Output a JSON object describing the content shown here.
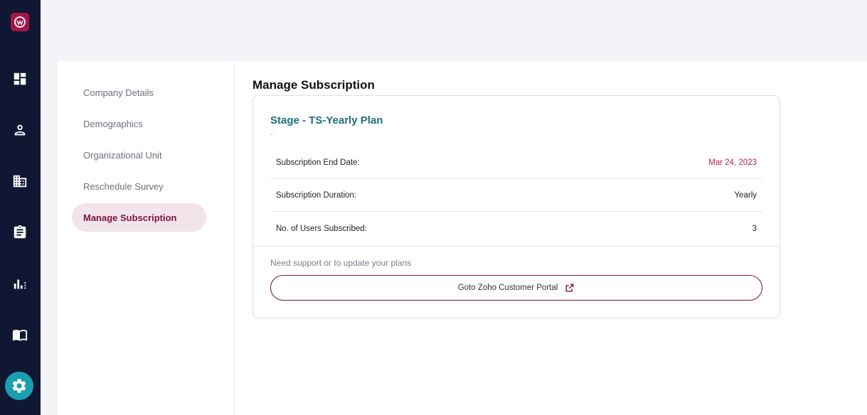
{
  "nav": {
    "items": [
      {
        "name": "dashboard",
        "icon": "dashboard-icon"
      },
      {
        "name": "people",
        "icon": "person-icon"
      },
      {
        "name": "company",
        "icon": "building-icon"
      },
      {
        "name": "surveys",
        "icon": "clipboard-icon"
      },
      {
        "name": "analytics",
        "icon": "bar-chart-icon"
      },
      {
        "name": "resources",
        "icon": "book-icon"
      },
      {
        "name": "settings",
        "icon": "gear-icon",
        "active": true
      }
    ]
  },
  "subnav": {
    "items": [
      {
        "label": "Company Details"
      },
      {
        "label": "Demographics"
      },
      {
        "label": "Organizational Unit"
      },
      {
        "label": "Reschedule Survey"
      },
      {
        "label": "Manage Subscription",
        "active": true
      }
    ]
  },
  "main": {
    "title": "Manage Subscription",
    "plan": {
      "name": "Stage - TS-Yearly Plan",
      "subtitle": "-"
    },
    "rows": [
      {
        "label": "Subscription End Date:",
        "value": "Mar 24, 2023",
        "value_color": "#b0244c"
      },
      {
        "label": "Subscription Duration:",
        "value": "Yearly"
      },
      {
        "label": "No. of Users Subscribed:",
        "value": "3"
      }
    ],
    "support_text": "Need support or to update your plans",
    "portal_button_label": "Goto Zoho Customer Portal",
    "portal_button_icon": "external-link-icon"
  },
  "colors": {
    "rail": "#0f1733",
    "accent": "#7a1441",
    "plan_name": "#1c6e7e",
    "settings_active": "#1a9eb1"
  }
}
